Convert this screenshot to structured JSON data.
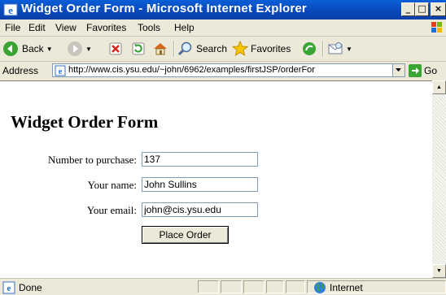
{
  "window": {
    "title": "Widget Order Form - Microsoft Internet Explorer",
    "minimize_glyph": "_",
    "maximize_glyph": "□",
    "close_glyph": "×"
  },
  "menu": {
    "items": [
      "File",
      "Edit",
      "View",
      "Favorites",
      "Tools",
      "Help"
    ]
  },
  "toolbar": {
    "back_label": "Back",
    "search_label": "Search",
    "favorites_label": "Favorites"
  },
  "address": {
    "label": "Address",
    "url": "http://www.cis.ysu.edu/~john/6962/examples/firstJSP/orderFor",
    "go_label": "Go"
  },
  "page": {
    "heading": "Widget Order Form",
    "fields": [
      {
        "label": "Number to purchase:",
        "value": "137"
      },
      {
        "label": "Your name:",
        "value": "John Sullins"
      },
      {
        "label": "Your email:",
        "value": "john@cis.ysu.edu"
      }
    ],
    "submit_label": "Place Order"
  },
  "status": {
    "text": "Done",
    "zone": "Internet"
  },
  "colors": {
    "titlebar": "#0a5fd8",
    "chrome": "#ece9d8"
  }
}
